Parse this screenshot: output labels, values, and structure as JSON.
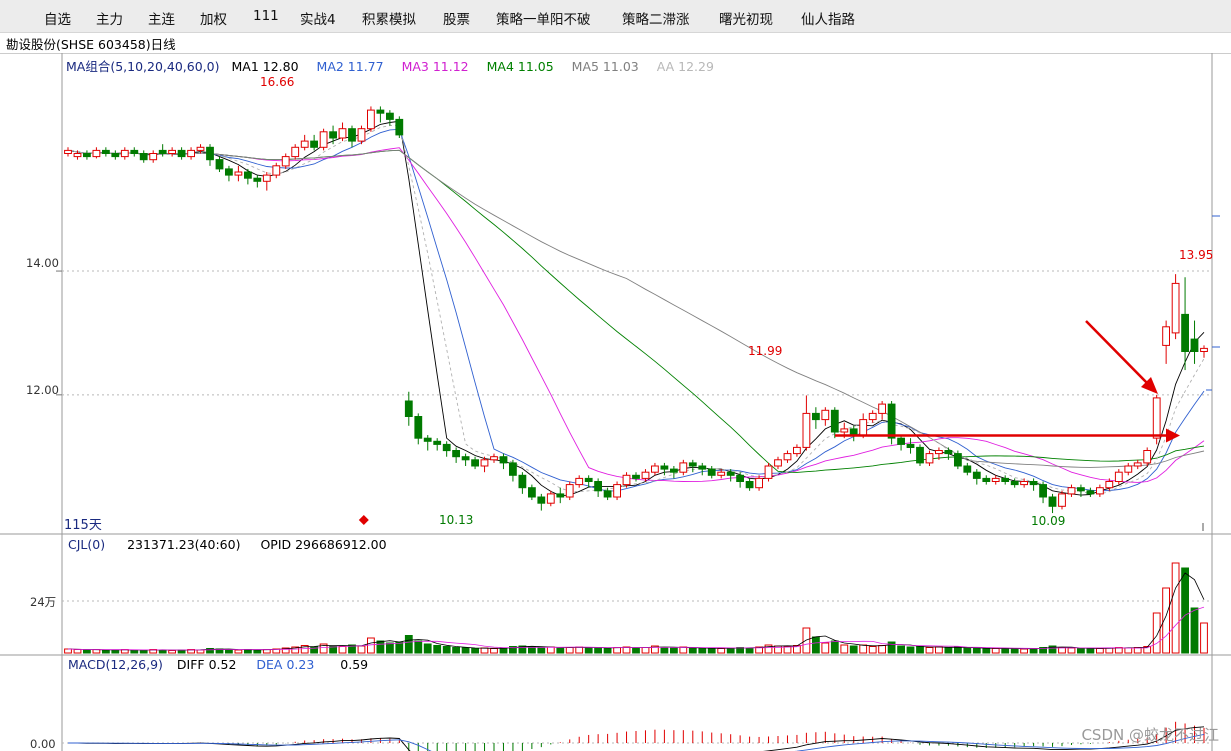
{
  "menu": [
    {
      "label": "自选"
    },
    {
      "label": "主力"
    },
    {
      "label": "主连"
    },
    {
      "label": "加权"
    },
    {
      "label": "111"
    },
    {
      "label": "实战4"
    },
    {
      "label": "积累模拟"
    },
    {
      "label": "股票"
    },
    {
      "label": "策略一单阳不破"
    },
    {
      "label": "策略二滞涨"
    },
    {
      "label": "曙光初现"
    },
    {
      "label": "仙人指路"
    }
  ],
  "stock_title": "勘设股份(SHSE 603458)日线",
  "ma_legend": {
    "group": "MA组合(5,10,20,40,60,0)",
    "ma1": "MA1 12.80",
    "ma2": "MA2 11.77",
    "ma3": "MA3 11.12",
    "ma4": "MA4 11.05",
    "ma5": "MA5 11.03",
    "aa": "AA 12.29"
  },
  "cjl_legend": {
    "name": "CJL(0)",
    "value": "231371.23(40:60)",
    "opid": "OPID 296686912.00"
  },
  "macd_legend": {
    "name": "MACD(12,26,9)",
    "diff": "DIFF 0.52",
    "dea": "DEA 0.23",
    "macd": "0.59"
  },
  "axis": {
    "price_14": "14.00",
    "price_12": "12.00",
    "vol_24w": "24万",
    "macd_0": "0.00",
    "days": "115天"
  },
  "annotations": {
    "high_left": "16.66",
    "low_left": "10.13",
    "high_mid": "11.99",
    "low_right": "10.09",
    "high_right": "13.95"
  },
  "colors": {
    "up": "#e00000",
    "down": "#007a00",
    "ma1": "#000000",
    "ma2": "#3060d0",
    "ma3": "#e020e0",
    "ma4": "#008000",
    "ma5": "#808080",
    "aa": "#b0b0b0",
    "arrow": "#e00000"
  },
  "watermark": "CSDN @蛟龙不过江",
  "chart_data": {
    "type": "candlestick",
    "ylim": [
      9.8,
      17.2
    ],
    "candles": [
      [
        15.9,
        15.95,
        15.85,
        16.0
      ],
      [
        15.85,
        15.9,
        15.8,
        15.95
      ],
      [
        15.9,
        15.85,
        15.8,
        15.95
      ],
      [
        15.85,
        15.95,
        15.82,
        16.0
      ],
      [
        15.95,
        15.9,
        15.85,
        16.0
      ],
      [
        15.9,
        15.85,
        15.8,
        15.95
      ],
      [
        15.85,
        15.95,
        15.8,
        16.0
      ],
      [
        15.95,
        15.9,
        15.85,
        16.0
      ],
      [
        15.9,
        15.8,
        15.75,
        15.95
      ],
      [
        15.8,
        15.9,
        15.75,
        15.95
      ],
      [
        15.95,
        15.9,
        15.85,
        16.05
      ],
      [
        15.9,
        15.95,
        15.85,
        16.0
      ],
      [
        15.95,
        15.85,
        15.8,
        16.0
      ],
      [
        15.85,
        15.95,
        15.8,
        16.0
      ],
      [
        15.95,
        16.0,
        15.9,
        16.05
      ],
      [
        16.0,
        15.8,
        15.7,
        16.05
      ],
      [
        15.8,
        15.65,
        15.6,
        15.85
      ],
      [
        15.65,
        15.55,
        15.45,
        15.7
      ],
      [
        15.55,
        15.6,
        15.45,
        15.7
      ],
      [
        15.6,
        15.5,
        15.4,
        15.65
      ],
      [
        15.5,
        15.45,
        15.35,
        15.55
      ],
      [
        15.45,
        15.55,
        15.3,
        15.6
      ],
      [
        15.55,
        15.7,
        15.5,
        15.75
      ],
      [
        15.7,
        15.85,
        15.65,
        15.9
      ],
      [
        15.85,
        16.0,
        15.8,
        16.05
      ],
      [
        16.0,
        16.1,
        15.95,
        16.2
      ],
      [
        16.1,
        16.0,
        15.95,
        16.2
      ],
      [
        16.0,
        16.25,
        15.95,
        16.3
      ],
      [
        16.25,
        16.15,
        16.05,
        16.35
      ],
      [
        16.15,
        16.3,
        16.1,
        16.4
      ],
      [
        16.3,
        16.1,
        16.0,
        16.35
      ],
      [
        16.1,
        16.3,
        16.05,
        16.35
      ],
      [
        16.3,
        16.6,
        16.25,
        16.66
      ],
      [
        16.6,
        16.55,
        16.4,
        16.66
      ],
      [
        16.55,
        16.45,
        16.35,
        16.6
      ],
      [
        16.45,
        16.2,
        16.15,
        16.5
      ],
      [
        11.9,
        11.65,
        11.5,
        12.05
      ],
      [
        11.65,
        11.3,
        11.2,
        11.7
      ],
      [
        11.3,
        11.25,
        11.1,
        11.35
      ],
      [
        11.25,
        11.2,
        11.1,
        11.3
      ],
      [
        11.2,
        11.1,
        11.0,
        11.25
      ],
      [
        11.1,
        11.0,
        10.9,
        11.15
      ],
      [
        11.0,
        10.95,
        10.85,
        11.05
      ],
      [
        10.95,
        10.85,
        10.8,
        11.0
      ],
      [
        10.85,
        10.95,
        10.75,
        11.0
      ],
      [
        10.95,
        11.0,
        10.9,
        11.05
      ],
      [
        11.0,
        10.9,
        10.8,
        11.05
      ],
      [
        10.9,
        10.7,
        10.6,
        10.95
      ],
      [
        10.7,
        10.5,
        10.4,
        10.75
      ],
      [
        10.5,
        10.35,
        10.3,
        10.55
      ],
      [
        10.35,
        10.25,
        10.13,
        10.4
      ],
      [
        10.25,
        10.4,
        10.2,
        10.45
      ],
      [
        10.4,
        10.35,
        10.25,
        10.5
      ],
      [
        10.35,
        10.55,
        10.3,
        10.6
      ],
      [
        10.55,
        10.65,
        10.5,
        10.7
      ],
      [
        10.65,
        10.6,
        10.5,
        10.7
      ],
      [
        10.6,
        10.45,
        10.35,
        10.65
      ],
      [
        10.45,
        10.35,
        10.3,
        10.5
      ],
      [
        10.35,
        10.55,
        10.3,
        10.6
      ],
      [
        10.55,
        10.7,
        10.5,
        10.75
      ],
      [
        10.7,
        10.65,
        10.6,
        10.75
      ],
      [
        10.65,
        10.75,
        10.6,
        10.8
      ],
      [
        10.75,
        10.85,
        10.7,
        10.9
      ],
      [
        10.85,
        10.8,
        10.7,
        10.9
      ],
      [
        10.8,
        10.75,
        10.65,
        10.85
      ],
      [
        10.75,
        10.9,
        10.7,
        10.95
      ],
      [
        10.9,
        10.85,
        10.75,
        10.95
      ],
      [
        10.85,
        10.8,
        10.7,
        10.9
      ],
      [
        10.8,
        10.7,
        10.65,
        10.85
      ],
      [
        10.7,
        10.75,
        10.65,
        10.8
      ],
      [
        10.75,
        10.7,
        10.6,
        10.8
      ],
      [
        10.7,
        10.6,
        10.5,
        10.75
      ],
      [
        10.6,
        10.5,
        10.45,
        10.65
      ],
      [
        10.5,
        10.65,
        10.45,
        10.7
      ],
      [
        10.65,
        10.85,
        10.6,
        10.9
      ],
      [
        10.85,
        10.95,
        10.8,
        11.0
      ],
      [
        10.95,
        11.05,
        10.9,
        11.1
      ],
      [
        11.05,
        11.15,
        11.0,
        11.2
      ],
      [
        11.15,
        11.7,
        11.1,
        11.99
      ],
      [
        11.7,
        11.6,
        11.45,
        11.8
      ],
      [
        11.6,
        11.75,
        11.5,
        11.8
      ],
      [
        11.75,
        11.4,
        11.3,
        11.8
      ],
      [
        11.4,
        11.45,
        11.3,
        11.55
      ],
      [
        11.45,
        11.35,
        11.25,
        11.5
      ],
      [
        11.35,
        11.6,
        11.3,
        11.7
      ],
      [
        11.6,
        11.7,
        11.55,
        11.75
      ],
      [
        11.7,
        11.85,
        11.6,
        11.9
      ],
      [
        11.85,
        11.3,
        11.2,
        11.9
      ],
      [
        11.3,
        11.2,
        11.1,
        11.35
      ],
      [
        11.2,
        11.15,
        11.05,
        11.3
      ],
      [
        11.15,
        10.9,
        10.85,
        11.2
      ],
      [
        10.9,
        11.05,
        10.85,
        11.1
      ],
      [
        11.05,
        11.1,
        10.95,
        11.15
      ],
      [
        11.1,
        11.05,
        10.95,
        11.15
      ],
      [
        11.05,
        10.85,
        10.8,
        11.1
      ],
      [
        10.85,
        10.75,
        10.7,
        10.9
      ],
      [
        10.75,
        10.65,
        10.55,
        10.8
      ],
      [
        10.65,
        10.6,
        10.55,
        10.7
      ],
      [
        10.6,
        10.65,
        10.55,
        10.7
      ],
      [
        10.65,
        10.6,
        10.55,
        10.7
      ],
      [
        10.6,
        10.55,
        10.5,
        10.65
      ],
      [
        10.55,
        10.6,
        10.5,
        10.65
      ],
      [
        10.6,
        10.55,
        10.45,
        10.65
      ],
      [
        10.55,
        10.35,
        10.25,
        10.6
      ],
      [
        10.35,
        10.2,
        10.09,
        10.4
      ],
      [
        10.2,
        10.4,
        10.15,
        10.45
      ],
      [
        10.4,
        10.5,
        10.35,
        10.55
      ],
      [
        10.5,
        10.45,
        10.35,
        10.55
      ],
      [
        10.45,
        10.4,
        10.35,
        10.5
      ],
      [
        10.4,
        10.5,
        10.35,
        10.55
      ],
      [
        10.5,
        10.6,
        10.45,
        10.65
      ],
      [
        10.6,
        10.75,
        10.55,
        10.8
      ],
      [
        10.75,
        10.85,
        10.7,
        10.9
      ],
      [
        10.85,
        10.9,
        10.8,
        10.95
      ],
      [
        10.9,
        11.1,
        10.85,
        11.15
      ],
      [
        11.3,
        11.95,
        11.2,
        12.0
      ],
      [
        12.8,
        13.1,
        12.5,
        13.2
      ],
      [
        13.0,
        13.8,
        12.9,
        13.95
      ],
      [
        13.3,
        12.7,
        12.4,
        13.9
      ],
      [
        12.9,
        12.7,
        12.5,
        13.2
      ],
      [
        12.7,
        12.75,
        12.6,
        12.8
      ]
    ],
    "volumes": [
      0.8,
      0.7,
      0.6,
      0.7,
      0.6,
      0.6,
      0.7,
      0.5,
      0.6,
      0.7,
      0.6,
      0.5,
      0.6,
      0.7,
      0.6,
      0.9,
      0.8,
      0.7,
      0.6,
      0.7,
      0.6,
      0.7,
      0.8,
      1.0,
      1.2,
      1.5,
      1.2,
      1.8,
      1.4,
      1.3,
      1.6,
      1.4,
      3.0,
      2.4,
      2.0,
      2.2,
      3.5,
      2.4,
      1.8,
      1.5,
      1.3,
      1.1,
      1.0,
      0.9,
      1.0,
      0.9,
      1.0,
      1.3,
      1.4,
      1.3,
      1.1,
      1.2,
      1.0,
      1.1,
      1.2,
      1.0,
      1.1,
      1.0,
      1.1,
      1.2,
      1.0,
      1.1,
      1.4,
      1.1,
      1.0,
      1.2,
      1.0,
      0.9,
      1.0,
      0.9,
      1.0,
      1.1,
      1.0,
      1.2,
      1.6,
      1.4,
      1.3,
      1.5,
      5.0,
      3.2,
      2.0,
      2.4,
      1.6,
      1.4,
      1.6,
      1.3,
      1.5,
      2.2,
      1.4,
      1.2,
      1.3,
      1.1,
      1.2,
      1.1,
      1.2,
      1.0,
      1.0,
      0.9,
      0.9,
      0.9,
      0.9,
      0.8,
      0.9,
      1.1,
      1.4,
      1.1,
      1.0,
      0.9,
      0.9,
      0.9,
      1.0,
      1.1,
      1.0,
      1.1,
      1.3,
      8.0,
      13.0,
      18.0,
      17.0,
      9.0,
      6.0
    ]
  }
}
